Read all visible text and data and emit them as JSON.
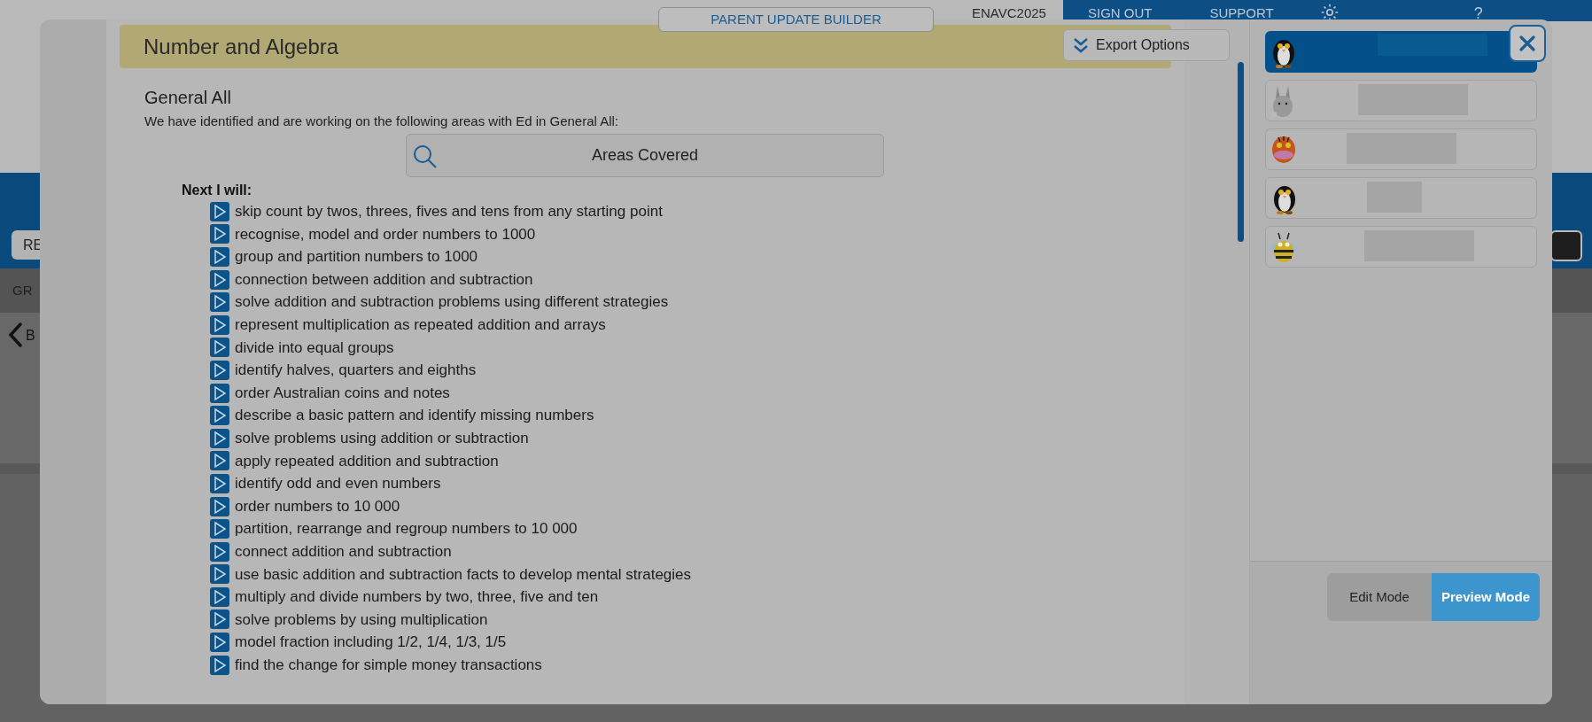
{
  "background_app": {
    "banner_button": "PARENT UPDATE BUILDER",
    "account_code": "ENAVC2025",
    "nav": [
      "SIGN OUT",
      "SUPPORT"
    ],
    "help": "?",
    "left_controls": [
      "RE",
      "GR",
      "B"
    ]
  },
  "modal": {
    "title": "Number and Algebra",
    "export_button": "Export Options",
    "section_title": "General All",
    "intro": "We have identified and are working on the following areas with Ed in General All:",
    "search_button": "Areas Covered",
    "list_heading": "Next I will:",
    "items": [
      "skip count by twos, threes, fives and tens from any starting point",
      "recognise, model and order numbers to 1000",
      "group and partition numbers to 1000",
      "connection between addition and subtraction",
      "solve addition and subtraction problems using different strategies",
      "represent multiplication as repeated addition and arrays",
      "divide into equal groups",
      "identify halves, quarters and eighths",
      "order Australian coins and notes",
      "describe a basic pattern and identify missing numbers",
      "solve problems using addition or subtraction",
      "apply repeated addition and subtraction",
      "identify odd and even numbers",
      "order numbers to 10 000",
      "partition, rearrange and regroup numbers to 10 000",
      "connect addition and subtraction",
      "use basic addition and subtraction facts to develop mental strategies",
      "multiply and divide numbers by two, three, five and ten",
      "solve problems by using multiplication",
      "model fraction including 1/2, 1/4, 1/3, 1/5",
      "find the change for simple money transactions"
    ]
  },
  "students": [
    {
      "kind": "penguin",
      "selected": true
    },
    {
      "kind": "bunny",
      "selected": false
    },
    {
      "kind": "tiger",
      "selected": false
    },
    {
      "kind": "penguin",
      "selected": false
    },
    {
      "kind": "bee",
      "selected": false
    }
  ],
  "modes": [
    {
      "label": "Edit Mode",
      "selected": false
    },
    {
      "label": "Preview Mode",
      "selected": true
    }
  ]
}
